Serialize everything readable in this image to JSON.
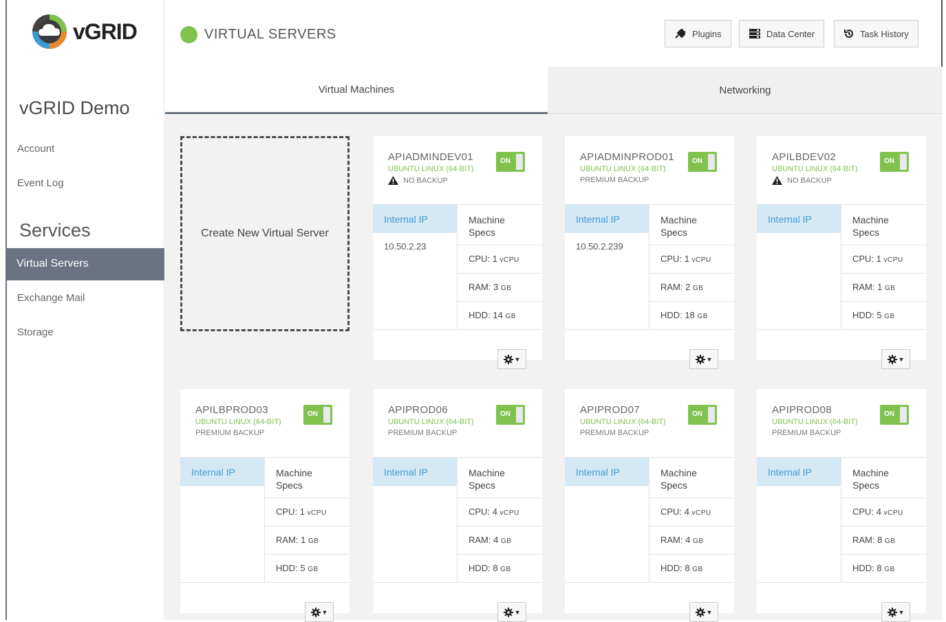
{
  "brand": {
    "name": "vGRID",
    "trademark": ""
  },
  "sidebar": {
    "org_name": "vGRID Demo",
    "links": [
      "Account",
      "Event Log"
    ],
    "section_title": "Services",
    "services": [
      "Virtual Servers",
      "Exchange Mail",
      "Storage"
    ],
    "active_service": "Virtual Servers"
  },
  "header": {
    "title": "VIRTUAL SERVERS",
    "status_color": "#7fc24d",
    "buttons": [
      {
        "label": "Plugins",
        "icon": "plug-icon"
      },
      {
        "label": "Data Center",
        "icon": "server-icon"
      },
      {
        "label": "Task History",
        "icon": "history-icon"
      }
    ]
  },
  "tabs": [
    {
      "label": "Virtual Machines",
      "active": true
    },
    {
      "label": "Networking",
      "active": false
    }
  ],
  "create_label": "Create New Virtual Server",
  "labels": {
    "toggle_on": "ON",
    "internal_ip": "Internal IP",
    "machine_specs": "Machine Specs",
    "cpu": "CPU:",
    "ram": "RAM:",
    "hdd": "HDD:",
    "cpu_unit": "vCPU",
    "gb_unit": "GB"
  },
  "accent_color": "#7fc24d",
  "servers": [
    {
      "name": "APIADMINDEV01",
      "os": "UBUNTU LINUX (64-BIT)",
      "backup": "NO BACKUP",
      "warning": true,
      "ip": "10.50.2.23",
      "cpu": "1",
      "ram": "3",
      "hdd": "14",
      "power": "on"
    },
    {
      "name": "APIADMINPROD01",
      "os": "UBUNTU LINUX (64-BIT)",
      "backup": "PREMIUM BACKUP",
      "warning": false,
      "ip": "10.50.2.239",
      "cpu": "1",
      "ram": "2",
      "hdd": "18",
      "power": "on"
    },
    {
      "name": "APILBDEV02",
      "os": "UBUNTU LINUX (64-BIT)",
      "backup": "NO BACKUP",
      "warning": true,
      "ip": "",
      "cpu": "1",
      "ram": "1",
      "hdd": "5",
      "power": "on"
    },
    {
      "name": "APILBPROD03",
      "os": "UBUNTU LINUX (64-BIT)",
      "backup": "PREMIUM BACKUP",
      "warning": false,
      "ip": "",
      "cpu": "1",
      "ram": "1",
      "hdd": "5",
      "power": "on"
    },
    {
      "name": "APIPROD06",
      "os": "UBUNTU LINUX (64-BIT)",
      "backup": "PREMIUM BACKUP",
      "warning": false,
      "ip": "",
      "cpu": "4",
      "ram": "4",
      "hdd": "8",
      "power": "on"
    },
    {
      "name": "APIPROD07",
      "os": "UBUNTU LINUX (64-BIT)",
      "backup": "PREMIUM BACKUP",
      "warning": false,
      "ip": "",
      "cpu": "4",
      "ram": "4",
      "hdd": "8",
      "power": "on"
    },
    {
      "name": "APIPROD08",
      "os": "UBUNTU LINUX (64-BIT)",
      "backup": "PREMIUM BACKUP",
      "warning": false,
      "ip": "",
      "cpu": "4",
      "ram": "8",
      "hdd": "8",
      "power": "on"
    }
  ]
}
